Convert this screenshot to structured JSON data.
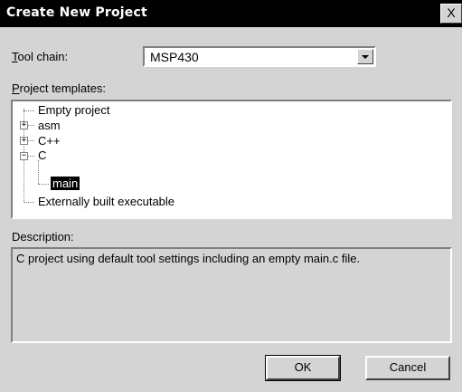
{
  "window": {
    "title": "Create New Project",
    "close_label": "X"
  },
  "toolchain": {
    "label_prefix": "",
    "label_underlined": "T",
    "label_rest": "ool chain:",
    "value": "MSP430"
  },
  "templates": {
    "label_underlined": "P",
    "label_rest": "roject templates:",
    "items": [
      {
        "label": "Empty project"
      },
      {
        "label": "asm",
        "expander": "+"
      },
      {
        "label": "C++",
        "expander": "+"
      },
      {
        "label": "C",
        "expander": "−"
      },
      {
        "label": "main",
        "selected": true
      },
      {
        "label": "Externally built executable"
      }
    ]
  },
  "description": {
    "label": "Description:",
    "text": "C project using default tool settings including an empty main.c file."
  },
  "buttons": {
    "ok": "OK",
    "cancel": "Cancel"
  }
}
